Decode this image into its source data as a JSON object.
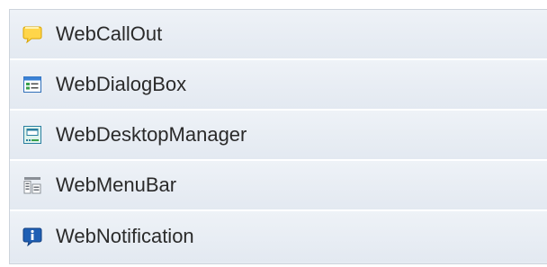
{
  "list": {
    "items": [
      {
        "label": "WebCallOut",
        "icon": "callout-icon"
      },
      {
        "label": "WebDialogBox",
        "icon": "dialog-box-icon"
      },
      {
        "label": "WebDesktopManager",
        "icon": "desktop-manager-icon"
      },
      {
        "label": "WebMenuBar",
        "icon": "menu-bar-icon"
      },
      {
        "label": "WebNotification",
        "icon": "notification-info-icon"
      }
    ]
  }
}
